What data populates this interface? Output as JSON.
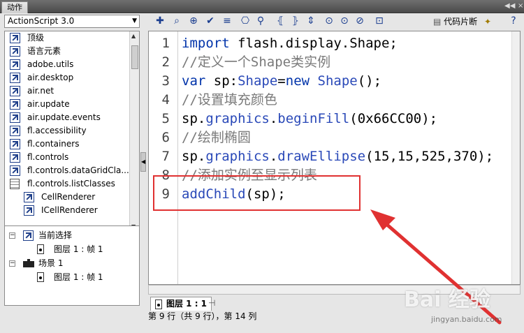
{
  "window": {
    "title": "动作"
  },
  "language_select": {
    "value": "ActionScript 3.0"
  },
  "tree": {
    "items": [
      {
        "label": "顶级",
        "icon": "book-icon"
      },
      {
        "label": "语言元素",
        "icon": "book-icon"
      },
      {
        "label": "adobe.utils",
        "icon": "book-icon"
      },
      {
        "label": "air.desktop",
        "icon": "book-icon"
      },
      {
        "label": "air.net",
        "icon": "book-icon"
      },
      {
        "label": "air.update",
        "icon": "book-icon"
      },
      {
        "label": "air.update.events",
        "icon": "book-icon"
      },
      {
        "label": "fl.accessibility",
        "icon": "book-icon"
      },
      {
        "label": "fl.containers",
        "icon": "book-icon"
      },
      {
        "label": "fl.controls",
        "icon": "book-icon"
      },
      {
        "label": "fl.controls.dataGridCla...",
        "icon": "book-icon"
      },
      {
        "label": "fl.controls.listClasses",
        "icon": "class-icon"
      },
      {
        "label": "CellRenderer",
        "icon": "book-icon"
      },
      {
        "label": "ICellRenderer",
        "icon": "book-icon"
      }
    ]
  },
  "outline": {
    "current_selection": "当前选择",
    "current_frame": "图层 1 : 帧 1",
    "scene": "场景 1",
    "scene_frame": "图层 1 : 帧 1"
  },
  "toolbar": {
    "snippets_label": "代码片断",
    "buttons": [
      "add-statement-icon",
      "find-icon",
      "target-path-icon",
      "check-syntax-icon",
      "auto-format-icon",
      "code-hint-icon",
      "debug-options-icon",
      "collapse-braces-icon",
      "collapse-selection-icon",
      "expand-all-icon",
      "apply-block-comment-icon",
      "apply-line-comment-icon",
      "remove-comment-icon",
      "show-hide-toolbox-icon"
    ]
  },
  "code": {
    "lines": [
      {
        "n": "1",
        "parts": [
          [
            "kw",
            "import"
          ],
          [
            "pl",
            " flash.display.Shape;"
          ]
        ]
      },
      {
        "n": "2",
        "parts": [
          [
            "cm",
            "//定义一个Shape类实例"
          ]
        ]
      },
      {
        "n": "3",
        "parts": [
          [
            "kw",
            "var"
          ],
          [
            "pl",
            " sp:"
          ],
          [
            "fn",
            "Shape"
          ],
          [
            "pl",
            "="
          ],
          [
            "kw",
            "new"
          ],
          [
            "pl",
            " "
          ],
          [
            "fn",
            "Shape"
          ],
          [
            "pl",
            "();"
          ]
        ]
      },
      {
        "n": "4",
        "parts": [
          [
            "cm",
            "//设置填充颜色"
          ]
        ]
      },
      {
        "n": "5",
        "parts": [
          [
            "pl",
            "sp."
          ],
          [
            "fn",
            "graphics"
          ],
          [
            "pl",
            "."
          ],
          [
            "fn",
            "beginFill"
          ],
          [
            "pl",
            "(0x66CC00);"
          ]
        ]
      },
      {
        "n": "6",
        "parts": [
          [
            "cm",
            "//绘制椭圆"
          ]
        ]
      },
      {
        "n": "7",
        "parts": [
          [
            "pl",
            "sp."
          ],
          [
            "fn",
            "graphics"
          ],
          [
            "pl",
            "."
          ],
          [
            "fn",
            "drawEllipse"
          ],
          [
            "pl",
            "(15,15,525,370);"
          ]
        ]
      },
      {
        "n": "8",
        "parts": [
          [
            "cm",
            "//添加实例至显示列表"
          ]
        ]
      },
      {
        "n": "9",
        "parts": [
          [
            "fn",
            "addChild"
          ],
          [
            "pl",
            "(sp);"
          ]
        ]
      }
    ]
  },
  "tab": {
    "label": "图层 1 : 1"
  },
  "status": {
    "text": "第 9 行（共 9 行），第 14 列"
  },
  "watermark": {
    "main": "Bai 经验",
    "sub": "jingyan.baidu.com"
  },
  "colors": {
    "keyword": "#0033aa",
    "comment": "#7a7a7a",
    "function": "#2a49b8",
    "annotation": "#e03131"
  }
}
